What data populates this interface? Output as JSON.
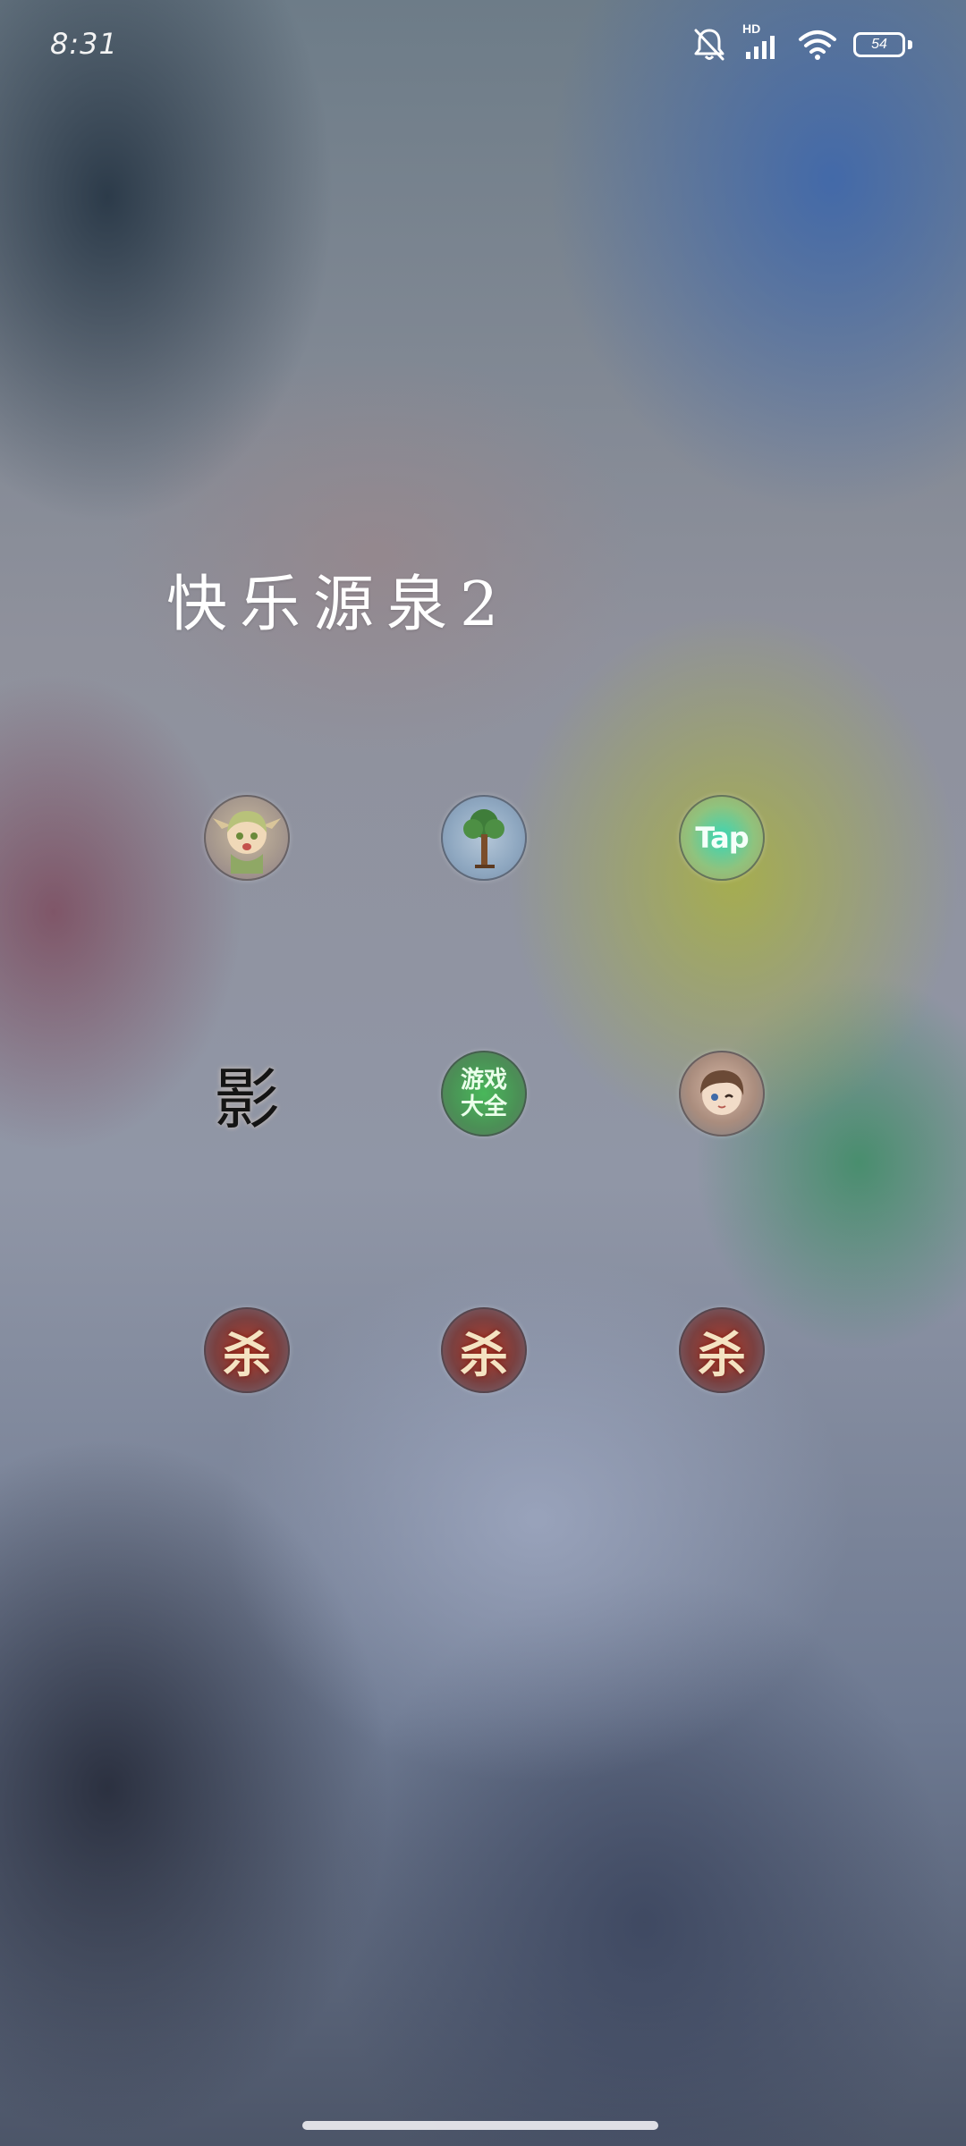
{
  "status_bar": {
    "time": "8:31",
    "network_label": "HD",
    "battery": "54",
    "icons": [
      "bell-off-icon",
      "signal-icon",
      "wifi-icon",
      "battery-icon"
    ]
  },
  "folder": {
    "title": "快乐源泉2",
    "apps": [
      {
        "name": "elf-girl-game",
        "icon": "anime-elf-icon",
        "glyph": "",
        "row": 1,
        "col": 1
      },
      {
        "name": "terraria",
        "icon": "tree-icon",
        "glyph": "",
        "row": 1,
        "col": 2
      },
      {
        "name": "taptap",
        "icon": "taptap-icon",
        "glyph": "Tap",
        "row": 1,
        "col": 3
      },
      {
        "name": "ying",
        "icon": "ying-calligraphy-icon",
        "glyph": "影",
        "row": 2,
        "col": 1
      },
      {
        "name": "games-collection",
        "icon": "games-daquan-icon",
        "glyph": "游戏\n大全",
        "row": 2,
        "col": 2
      },
      {
        "name": "anime-character-game",
        "icon": "anime-boy-icon",
        "glyph": "",
        "row": 2,
        "col": 3
      },
      {
        "name": "sanguosha-1",
        "icon": "sha-calligraphy-icon",
        "glyph": "杀",
        "row": 3,
        "col": 1
      },
      {
        "name": "sanguosha-2",
        "icon": "sha-calligraphy-icon",
        "glyph": "杀",
        "row": 3,
        "col": 2
      },
      {
        "name": "sanguosha-3",
        "icon": "sha-calligraphy-icon",
        "glyph": "杀",
        "row": 3,
        "col": 3
      }
    ]
  }
}
